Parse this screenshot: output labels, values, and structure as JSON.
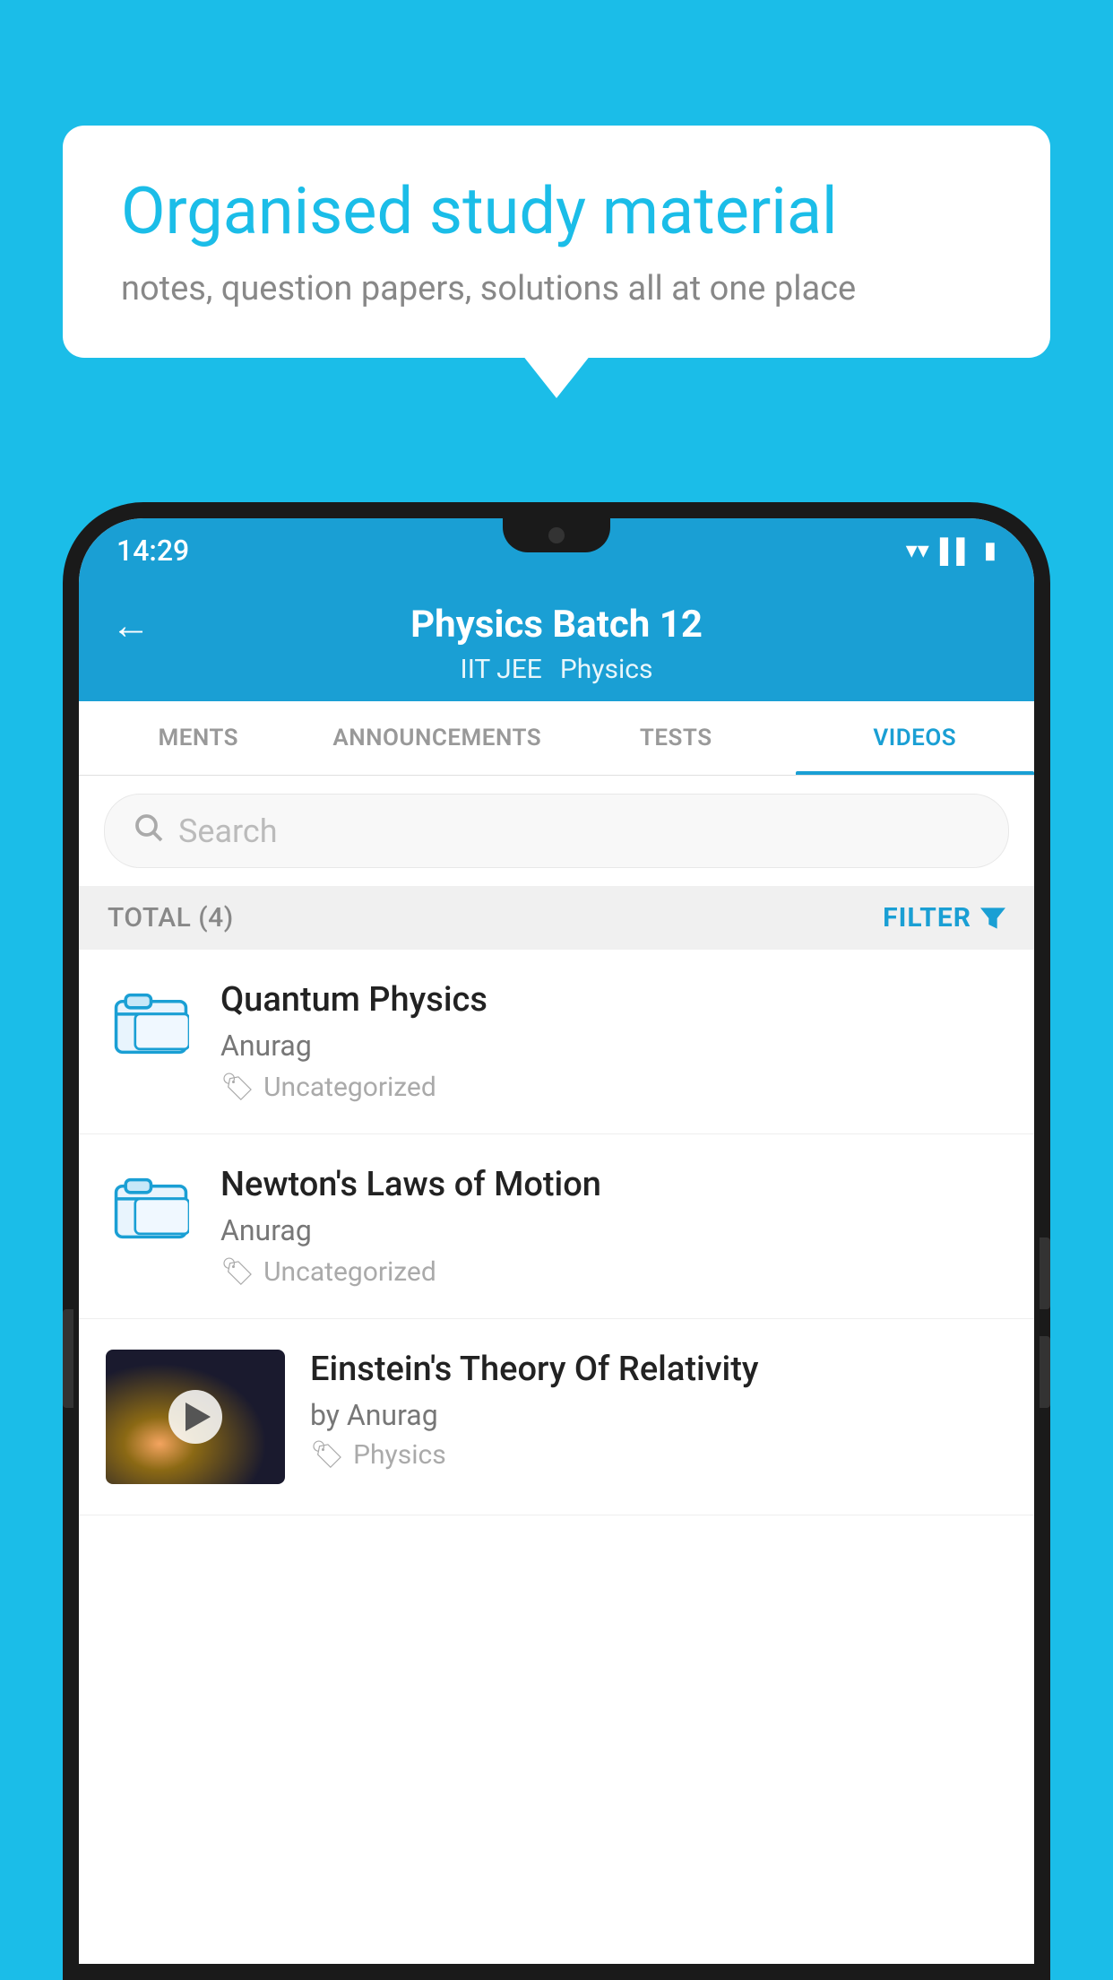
{
  "background_color": "#1bbde8",
  "bubble": {
    "title": "Organised study material",
    "subtitle": "notes, question papers, solutions all at one place"
  },
  "status_bar": {
    "time": "14:29",
    "signal_icon": "▼▲▌"
  },
  "header": {
    "title": "Physics Batch 12",
    "subtitle_1": "IIT JEE",
    "subtitle_2": "Physics",
    "back_label": "←"
  },
  "tabs": [
    {
      "label": "MENTS",
      "active": false
    },
    {
      "label": "ANNOUNCEMENTS",
      "active": false
    },
    {
      "label": "TESTS",
      "active": false
    },
    {
      "label": "VIDEOS",
      "active": true
    }
  ],
  "search": {
    "placeholder": "Search"
  },
  "filter_bar": {
    "total_label": "TOTAL (4)",
    "filter_label": "FILTER"
  },
  "videos": [
    {
      "title": "Quantum Physics",
      "author": "Anurag",
      "tag": "Uncategorized",
      "type": "folder"
    },
    {
      "title": "Newton's Laws of Motion",
      "author": "Anurag",
      "tag": "Uncategorized",
      "type": "folder"
    },
    {
      "title": "Einstein's Theory Of Relativity",
      "author": "by Anurag",
      "tag": "Physics",
      "type": "video"
    }
  ]
}
